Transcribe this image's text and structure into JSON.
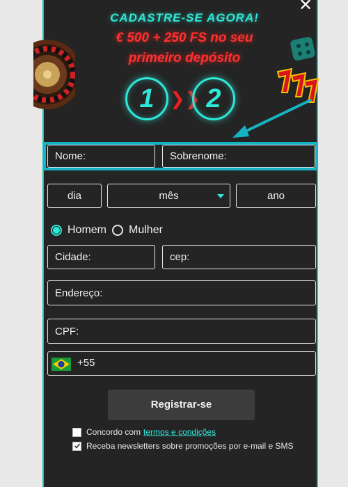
{
  "header": {
    "title": "CADASTRE-SE AGORA!",
    "offer_line1": "€ 500 + 250 FS no seu",
    "offer_line2": "primeiro depósito",
    "step1": "1",
    "step2": "2",
    "close_icon": "close-icon"
  },
  "form": {
    "name_placeholder": "Nome:",
    "surname_placeholder": "Sobrenome:",
    "day_label": "dia",
    "month_label": "mês",
    "year_label": "ano",
    "gender_male": "Homem",
    "gender_female": "Mulher",
    "gender_selected": "Homem",
    "city_placeholder": "Cidade:",
    "zip_placeholder": "cep:",
    "address_placeholder": "Endereço:",
    "cpf_placeholder": "CPF:",
    "phone_code": "+55",
    "register_button": "Registrar-se",
    "terms_text": "Concordo com",
    "terms_link": "termos e condições",
    "terms_checked": false,
    "newsletter_text": "Receba newsletters sobre promoções por e-mail e SMS",
    "newsletter_checked": true
  },
  "colors": {
    "accent": "#2ee8d8",
    "offer_red": "#ff3030",
    "panel_bg": "#242424",
    "highlight_border": "#16b4c2"
  }
}
